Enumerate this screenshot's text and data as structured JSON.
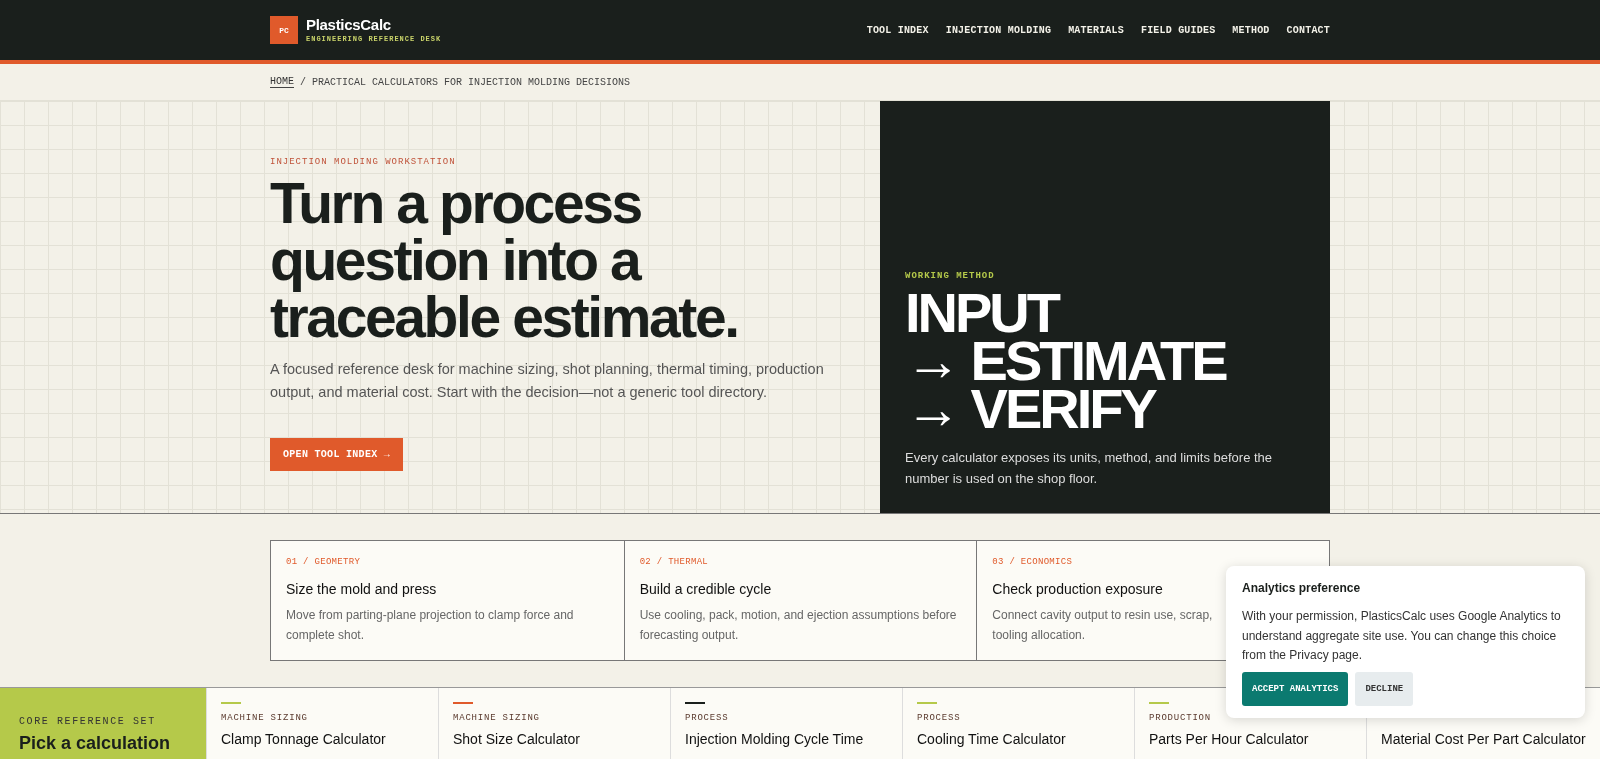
{
  "header": {
    "logo_mark": "PC",
    "brand": "PlasticsCalc",
    "tagline": "ENGINEERING REFERENCE DESK",
    "nav": [
      {
        "label": "TOOL INDEX"
      },
      {
        "label": "INJECTION MOLDING"
      },
      {
        "label": "MATERIALS"
      },
      {
        "label": "FIELD GUIDES"
      },
      {
        "label": "METHOD"
      },
      {
        "label": "CONTACT"
      }
    ]
  },
  "breadcrumb": {
    "home": "HOME",
    "separator": "/",
    "current": "PRACTICAL CALCULATORS FOR INJECTION MOLDING DECISIONS"
  },
  "hero": {
    "eyebrow": "INJECTION MOLDING WORKSTATION",
    "title": "Turn a process question into a traceable estimate.",
    "lead": "A focused reference desk for machine sizing, shot planning, thermal timing, production output, and material cost. Start with the decision—not a generic tool directory.",
    "button": "OPEN TOOL INDEX →"
  },
  "method_panel": {
    "eyebrow": "WORKING METHOD",
    "lines": [
      "INPUT",
      "→ ESTIMATE",
      "→ VERIFY"
    ],
    "text": "Every calculator exposes its units, method, and limits before the number is used on the shop floor."
  },
  "steps": [
    {
      "label": "01 / GEOMETRY",
      "title": "Size the mold and press",
      "text": "Move from parting-plane projection to clamp force and complete shot."
    },
    {
      "label": "02 / THERMAL",
      "title": "Build a credible cycle",
      "text": "Use cooling, pack, motion, and ejection assumptions before forecasting output."
    },
    {
      "label": "03 / ECONOMICS",
      "title": "Check production exposure",
      "text_lines": [
        "Connect cavity output to resin use, scrap,",
        "tooling allocation."
      ]
    }
  ],
  "reference_set": {
    "eyebrow": "CORE REFERENCE SET",
    "title": "Pick a calculation",
    "tools": [
      {
        "category": "MACHINE SIZING",
        "title": "Clamp Tonnage Calculator",
        "color": "#b5c94a"
      },
      {
        "category": "MACHINE SIZING",
        "title": "Shot Size Calculator",
        "color": "#e05a2b"
      },
      {
        "category": "PROCESS",
        "title": "Injection Molding Cycle Time",
        "color": "#1a1f1c"
      },
      {
        "category": "PROCESS",
        "title": "Cooling Time Calculator",
        "color": "#b5c94a"
      },
      {
        "category": "PRODUCTION",
        "title": "Parts Per Hour Calculator",
        "color": "#b5c94a"
      },
      {
        "title": "Material Cost Per Part Calculator"
      }
    ]
  },
  "consent": {
    "title": "Analytics preference",
    "text": "With your permission, PlasticsCalc uses Google Analytics to understand aggregate site use. You can change this choice from the Privacy page.",
    "accept": "ACCEPT ANALYTICS",
    "decline": "DECLINE"
  }
}
